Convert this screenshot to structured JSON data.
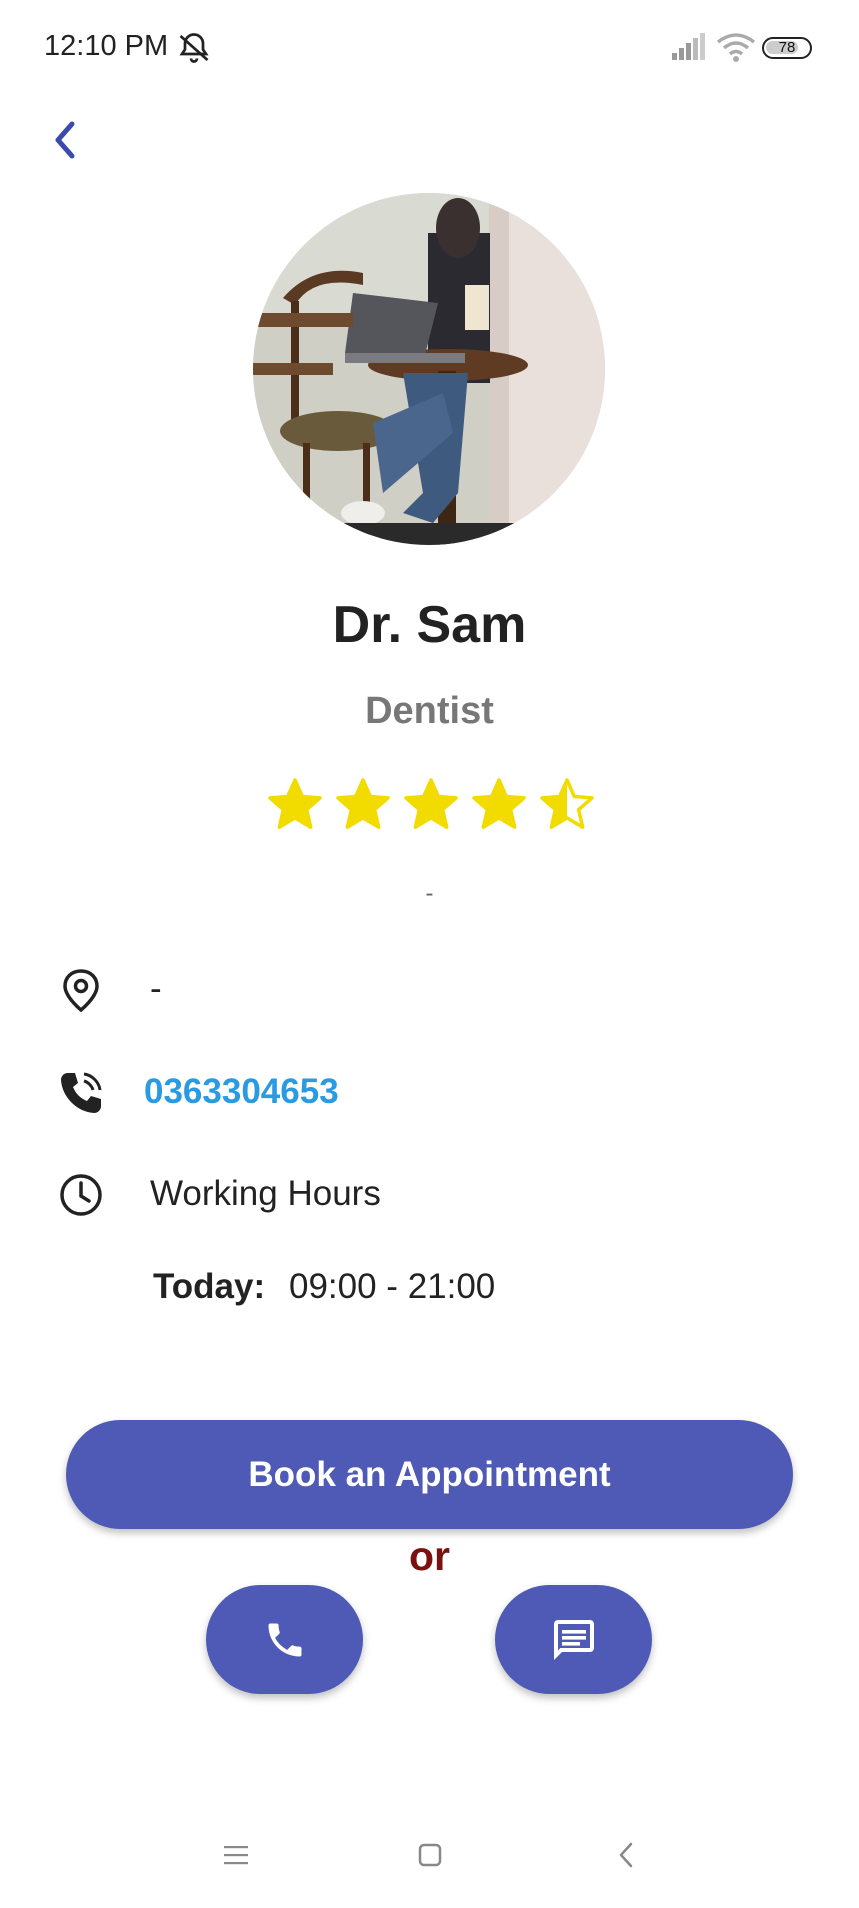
{
  "status_bar": {
    "time": "12:10 PM",
    "battery": "78",
    "battery_level": 0.78
  },
  "profile": {
    "name": "Dr. Sam",
    "specialty": "Dentist",
    "rating": 4.5,
    "rating_caption": "-"
  },
  "info": {
    "location": "-",
    "phone": "0363304653",
    "working_hours_label": "Working Hours",
    "today_label": "Today:",
    "today_hours": "09:00 - 21:00"
  },
  "actions": {
    "book_label": "Book an Appointment",
    "or_label": "or"
  },
  "colors": {
    "primary": "#4e5ab5",
    "star": "#f2dc00",
    "link": "#2a9ae2",
    "or": "#7a1010",
    "subtitle": "#777777"
  },
  "icons": {
    "back": "chevron-left-icon",
    "location": "location-pin-icon",
    "phone": "phone-call-icon",
    "clock": "clock-icon",
    "call": "phone-icon",
    "message": "message-icon"
  }
}
